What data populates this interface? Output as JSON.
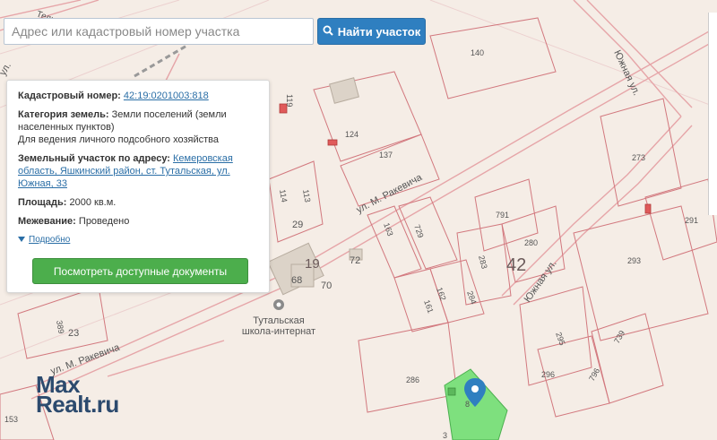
{
  "search": {
    "placeholder": "Адрес или кадастровый номер участка",
    "button_label": "Найти участок",
    "button_icon": "search-icon"
  },
  "info_card": {
    "cadastral_label": "Кадастровый номер:",
    "cadastral_value": "42:19:0201003:818",
    "category_label": "Категория земель:",
    "category_value": "Земли поселений (земли населенных пунктов)",
    "usage_value": "Для ведения личного подсобного хозяйства",
    "address_label": "Земельный участок по адресу:",
    "address_value": "Кемеровская область, Яшкинский район, ст. Тутальская, ул. Южная, 33",
    "area_label": "Площадь:",
    "area_value": "2000 кв.м.",
    "survey_label": "Межевание:",
    "survey_value": "Проведено",
    "more_label": "Подробно",
    "docs_button": "Посмотреть доступные документы"
  },
  "map": {
    "streets": [
      "ул. М. Ракевича",
      "ул. М. Ракевича",
      "Южная ул.",
      "Южная ул.",
      "ул.",
      "Тельмена"
    ],
    "block_labels": [
      "42",
      "19"
    ],
    "parcel_numbers": [
      "140",
      "119",
      "124",
      "137",
      "114",
      "113",
      "29",
      "163",
      "729",
      "791",
      "280",
      "283",
      "273",
      "291",
      "293",
      "72",
      "68",
      "70",
      "162",
      "284",
      "161",
      "295",
      "739",
      "296",
      "796",
      "286",
      "23",
      "389",
      "153",
      "8",
      "3"
    ],
    "poi_label_line1": "Тутальская",
    "poi_label_line2": "школа-интернат",
    "selected_parcel_color": "#7ee07e",
    "marker_color": "#2f7fc0"
  },
  "watermark": {
    "line1": "Max",
    "line2": "Realt.ru"
  }
}
